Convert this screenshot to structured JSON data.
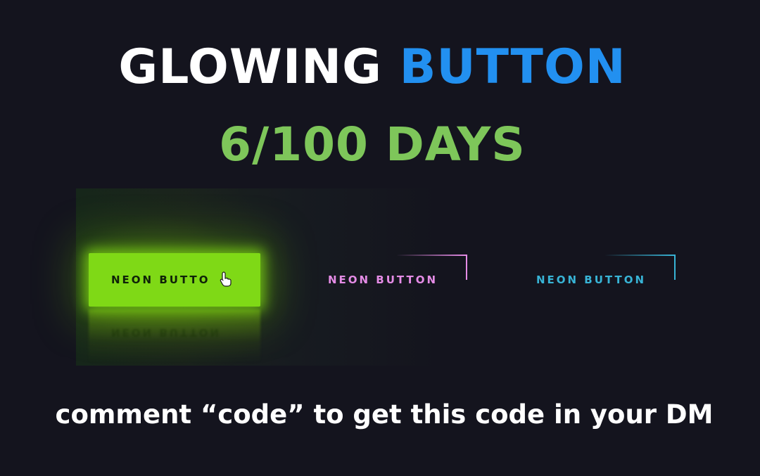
{
  "title": {
    "part1": "GLOWING ",
    "part2": "BUTTON"
  },
  "subtitle": "6/100 DAYS",
  "buttons": {
    "green": {
      "label": "NEON BUTTO",
      "color": "#7fd916"
    },
    "pink": {
      "label": "NEON BUTTON",
      "color": "#e58ce6"
    },
    "cyan": {
      "label": "NEON BUTTON",
      "color": "#38b4d6"
    }
  },
  "reflection_text": "NEON BUTTON",
  "caption": "comment “code” to get this code in your DM",
  "colors": {
    "background": "#14141e",
    "title_white": "#ffffff",
    "title_blue": "#2290f0",
    "subtitle_green": "#7ec65a"
  },
  "icons": {
    "cursor": "hand-pointer-icon"
  }
}
